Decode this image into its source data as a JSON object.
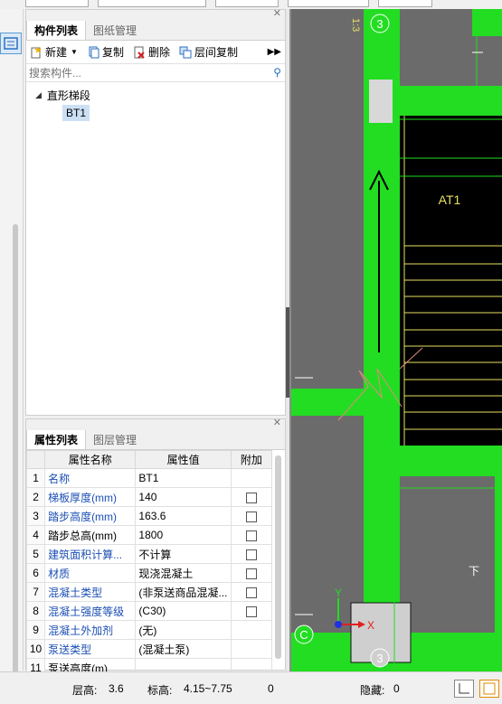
{
  "component_panel": {
    "tabs": [
      "构件列表",
      "图纸管理"
    ],
    "toolbar": {
      "new_label": "新建",
      "copy_label": "复制",
      "delete_label": "删除",
      "floor_copy_label": "层间复制"
    },
    "search": {
      "placeholder": "搜索构件..."
    },
    "tree": {
      "root_label": "直形梯段",
      "children": [
        "BT1"
      ]
    }
  },
  "property_panel": {
    "tabs": [
      "属性列表",
      "图层管理"
    ],
    "headers": {
      "name": "属性名称",
      "value": "属性值",
      "extra": "附加"
    },
    "rows": [
      {
        "num": "1",
        "name": "名称",
        "value": "BT1",
        "blue": true,
        "checkbox": false
      },
      {
        "num": "2",
        "name": "梯板厚度(mm)",
        "value": "140",
        "blue": true,
        "checkbox": true
      },
      {
        "num": "3",
        "name": "踏步高度(mm)",
        "value": "163.6",
        "blue": true,
        "checkbox": true
      },
      {
        "num": "4",
        "name": "踏步总高(mm)",
        "value": "1800",
        "blue": false,
        "checkbox": true
      },
      {
        "num": "5",
        "name": "建筑面积计算...",
        "value": "不计算",
        "blue": true,
        "checkbox": true
      },
      {
        "num": "6",
        "name": "材质",
        "value": "现浇混凝土",
        "blue": true,
        "checkbox": true
      },
      {
        "num": "7",
        "name": "混凝土类型",
        "value": "(非泵送商品混凝...",
        "blue": true,
        "checkbox": true
      },
      {
        "num": "8",
        "name": "混凝土强度等级",
        "value": "(C30)",
        "blue": true,
        "checkbox": true
      },
      {
        "num": "9",
        "name": "混凝土外加剂",
        "value": "(无)",
        "blue": true,
        "checkbox": false
      },
      {
        "num": "10",
        "name": "泵送类型",
        "value": "(混凝土泵)",
        "blue": true,
        "checkbox": false
      },
      {
        "num": "11",
        "name": "泵送高度(m)",
        "value": "",
        "blue": false,
        "checkbox": false
      }
    ]
  },
  "canvas": {
    "axis_top": "3",
    "axis_bottom": "3",
    "axis_left": "C",
    "stair_label": "AT1",
    "ucs_x": "X",
    "ucs_y": "Y",
    "dim_text": "1:3",
    "colors": {
      "background": "#000000",
      "green": "#22dd22",
      "yellow": "#e8e060",
      "gray": "#6b6b6b"
    }
  },
  "status": {
    "floor_height_label": "层高:",
    "floor_height_value": "3.6",
    "elevation_label": "标高:",
    "elevation_value": "4.15~7.75",
    "count_value": "0",
    "hidden_label": "隐藏:",
    "hidden_value": "0"
  }
}
